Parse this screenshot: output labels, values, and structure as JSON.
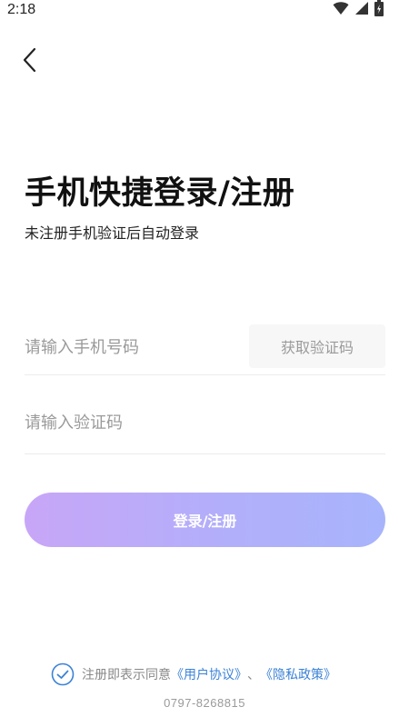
{
  "status_bar": {
    "time": "2:18",
    "icons": [
      "wifi-icon",
      "signal-icon",
      "battery-icon"
    ]
  },
  "header": {
    "back_icon": "chevron-left-icon"
  },
  "main": {
    "title": "手机快捷登录/注册",
    "subtitle": "未注册手机验证后自动登录",
    "phone_input": {
      "value": "",
      "placeholder": "请输入手机号码"
    },
    "get_code_label": "获取验证码",
    "code_input": {
      "value": "",
      "placeholder": "请输入验证码"
    },
    "login_label": "登录/注册"
  },
  "footer": {
    "agreement_prefix": "注册即表示同意",
    "user_agreement": "《用户协议》",
    "separator": "、",
    "privacy_policy": "《隐私政策》",
    "agree_checked": true,
    "phone": "0797-8268815"
  },
  "colors": {
    "link": "#3b82d6",
    "button_gradient_start": "#c8a6f7",
    "button_gradient_end": "#a7b4fb",
    "placeholder": "#9a9a9a"
  }
}
